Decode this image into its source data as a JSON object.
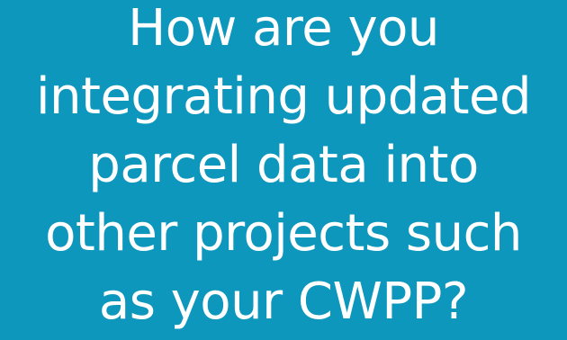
{
  "slide": {
    "background_color": "#0d97bd",
    "text_color": "#ffffff",
    "question_lines": [
      "How are you",
      "integrating updated",
      "parcel data into",
      "other projects such",
      "as your CWPP?"
    ]
  }
}
